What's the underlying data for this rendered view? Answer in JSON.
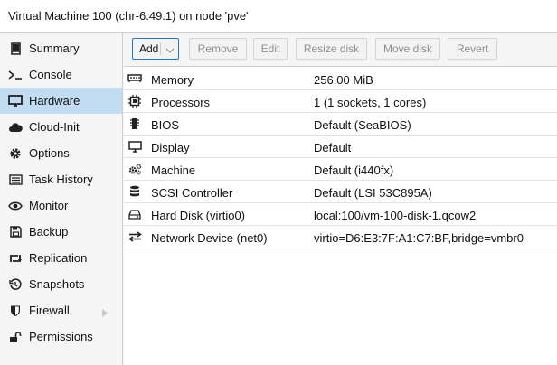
{
  "window": {
    "title": "Virtual Machine 100 (chr-6.49.1) on node 'pve'"
  },
  "sidebar": {
    "items": [
      {
        "label": "Summary",
        "icon": "book-icon"
      },
      {
        "label": "Console",
        "icon": "terminal-icon"
      },
      {
        "label": "Hardware",
        "icon": "desktop-icon",
        "active": true
      },
      {
        "label": "Cloud-Init",
        "icon": "cloud-icon"
      },
      {
        "label": "Options",
        "icon": "gear-icon"
      },
      {
        "label": "Task History",
        "icon": "list-icon"
      },
      {
        "label": "Monitor",
        "icon": "eye-icon"
      },
      {
        "label": "Backup",
        "icon": "floppy-icon"
      },
      {
        "label": "Replication",
        "icon": "retweet-icon"
      },
      {
        "label": "Snapshots",
        "icon": "history-icon"
      },
      {
        "label": "Firewall",
        "icon": "shield-icon",
        "expandable": true
      },
      {
        "label": "Permissions",
        "icon": "unlock-icon"
      }
    ]
  },
  "toolbar": {
    "add_label": "Add",
    "remove_label": "Remove",
    "edit_label": "Edit",
    "resize_label": "Resize disk",
    "move_label": "Move disk",
    "revert_label": "Revert"
  },
  "hardware": {
    "rows": [
      {
        "key": "Memory",
        "value": "256.00 MiB",
        "icon": "memory-icon"
      },
      {
        "key": "Processors",
        "value": "1 (1 sockets, 1 cores)",
        "icon": "cpu-icon"
      },
      {
        "key": "BIOS",
        "value": "Default (SeaBIOS)",
        "icon": "microchip-icon"
      },
      {
        "key": "Display",
        "value": "Default",
        "icon": "monitor-icon"
      },
      {
        "key": "Machine",
        "value": "Default (i440fx)",
        "icon": "cogs-icon"
      },
      {
        "key": "SCSI Controller",
        "value": "Default (LSI 53C895A)",
        "icon": "database-icon"
      },
      {
        "key": "Hard Disk (virtio0)",
        "value": "local:100/vm-100-disk-1.qcow2",
        "icon": "hdd-icon"
      },
      {
        "key": "Network Device (net0)",
        "value": "virtio=D6:E3:7F:A1:C7:BF,bridge=vmbr0",
        "icon": "exchange-icon"
      }
    ]
  },
  "colors": {
    "active_bg": "#c2ddf2",
    "add_border": "#2a73b8"
  }
}
